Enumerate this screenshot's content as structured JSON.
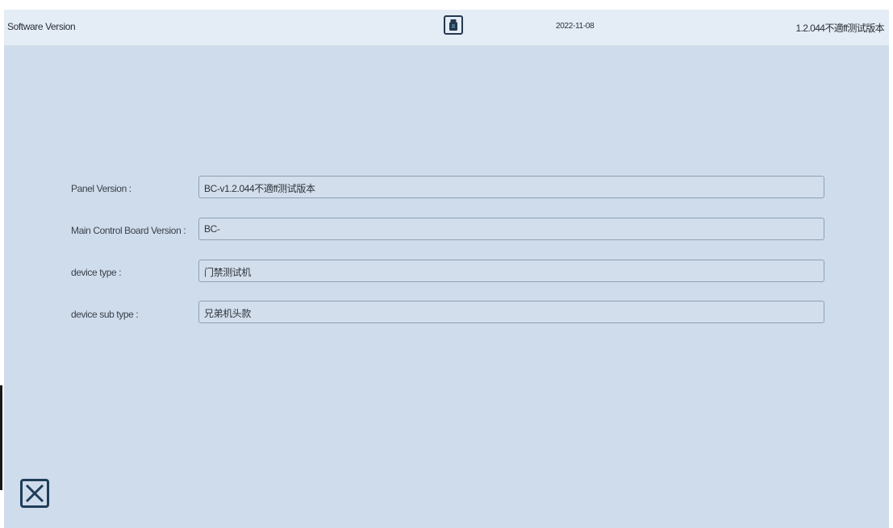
{
  "header": {
    "title": "Software Version",
    "date": "2022-11-08",
    "version": "1.2.044不適ff测试版本",
    "usb_icon": "usb-drive-icon"
  },
  "fields": [
    {
      "label": "Panel Version :",
      "value": "BC-v1.2.044不適ff测试版本"
    },
    {
      "label": "Main Control Board Version :",
      "value": "BC-"
    },
    {
      "label": "device type :",
      "value": "门禁测试机"
    },
    {
      "label": "device sub type :",
      "value": "兄弟机头款"
    }
  ],
  "footer": {
    "close_icon": "close-icon"
  },
  "colors": {
    "background": "#cfdcec",
    "header_background": "#e4ecf5",
    "field_border": "#8fa0b3",
    "icon_color": "#1f3d58"
  }
}
